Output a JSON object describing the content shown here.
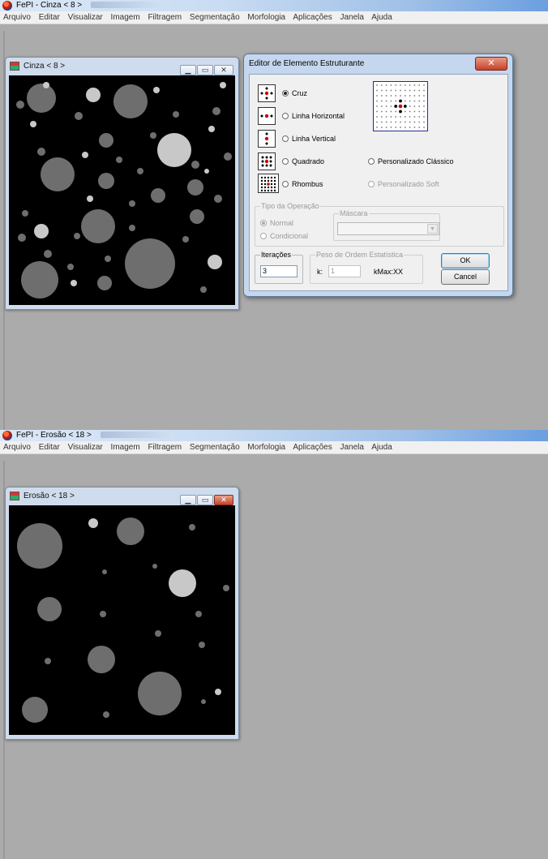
{
  "app1": {
    "title": "FePI - Cinza   < 8 >",
    "menu": [
      "Arquivo",
      "Editar",
      "Visualizar",
      "Imagem",
      "Filtragem",
      "Segmentação",
      "Morfologia",
      "Aplicações",
      "Janela",
      "Ajuda"
    ]
  },
  "window1": {
    "title": "Cinza   < 8 >",
    "minimize_icon": "minimize-icon",
    "maximize_icon": "maximize-icon",
    "close_icon": "close-icon"
  },
  "dialog": {
    "title": "Editor de Elemento Estruturante",
    "close_label": "✕",
    "shapes": {
      "cruz": "Cruz",
      "linha_horizontal": "Linha Horizontal",
      "linha_vertical": "Linha Vertical",
      "quadrado": "Quadrado",
      "rhombus": "Rhombus",
      "personalizado_classico": "Personalizado Clássico",
      "personalizado_soft": "Personalizado Soft",
      "selected": "Cruz"
    },
    "operacao": {
      "group_label": "Tipo da Operação",
      "normal": "Normal",
      "condicional": "Condicional",
      "selected": "Normal"
    },
    "mascara": {
      "group_label": "Máscara",
      "value": ""
    },
    "iteracoes": {
      "group_label": "Iterações",
      "value": "3"
    },
    "peso": {
      "group_label": "Peso de Ordem Estatística",
      "k_label": "k:",
      "k_value": "1",
      "kmax_label": "kMax:XX"
    },
    "ok_label": "OK",
    "cancel_label": "Cancel"
  },
  "app2": {
    "title": "FePI - Erosão   < 18 >",
    "menu": [
      "Arquivo",
      "Editar",
      "Visualizar",
      "Imagem",
      "Filtragem",
      "Segmentação",
      "Morfologia",
      "Aplicações",
      "Janela",
      "Ajuda"
    ]
  },
  "window2": {
    "title": "Erosão   < 18 >"
  },
  "colors": {
    "mdi_background": "#ababab",
    "image_background": "#000000",
    "circle_gray": "#6e6e6e",
    "circle_light": "#c8c8c8",
    "selected_center": "#cc0000"
  }
}
